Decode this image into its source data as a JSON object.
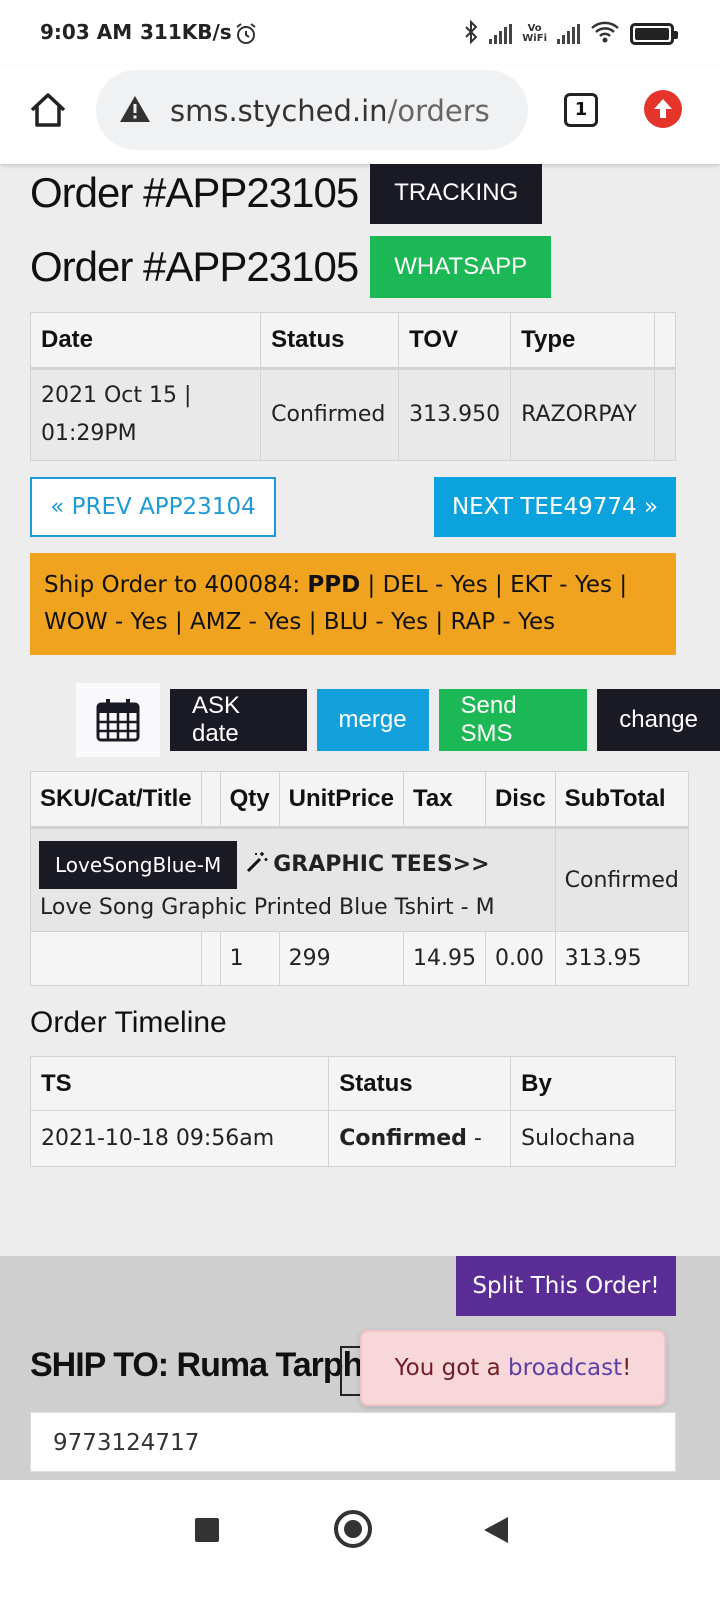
{
  "status_bar": {
    "time": "9:03 AM",
    "speed": "311KB/s",
    "vo": "Vo",
    "wifi": "WiFi"
  },
  "browser": {
    "url_domain": "sms.styched.in",
    "url_path": "/orders",
    "tab_count": "1"
  },
  "order": {
    "title": "Order #APP23105",
    "tracking_label": "TRACKING",
    "whatsapp_label": "WHATSAPP"
  },
  "info_table": {
    "headers": [
      "Date",
      "Status",
      "TOV",
      "Type"
    ],
    "row": {
      "date_line1": "2021 Oct 15 |",
      "date_line2": "01:29PM",
      "status": "Confirmed",
      "tov": "313.950",
      "type": "RAZORPAY"
    }
  },
  "nav": {
    "prev_label": "« PREV APP23104",
    "next_label": "NEXT TEE49774 »"
  },
  "ship_alert": {
    "prefix": "Ship Order to 400084: ",
    "bold": "PPD",
    "rest": " | DEL - Yes | EKT - Yes | WOW - Yes | AMZ - Yes | BLU - Yes | RAP - Yes"
  },
  "actions": {
    "ask_date": "ASK date",
    "merge": "merge",
    "send_sms": "Send SMS",
    "change": "change"
  },
  "items_table": {
    "headers": [
      "SKU/Cat/Title",
      "",
      "Qty",
      "UnitPrice",
      "Tax",
      "Disc",
      "SubTotal"
    ],
    "item": {
      "sku": "LoveSongBlue-M",
      "category": "GRAPHIC TEES>>",
      "title": "Love Song Graphic Printed Blue Tshirt - M",
      "status": "Confirmed",
      "qty": "1",
      "unit_price": "299",
      "tax": "14.95",
      "disc": "0.00",
      "subtotal": "313.95"
    }
  },
  "timeline": {
    "title": "Order Timeline",
    "headers": [
      "TS",
      "Status",
      "By"
    ],
    "row": {
      "ts": "2021-10-18 09:56am",
      "status": "Confirmed",
      "status_suffix": " -",
      "by": "Sulochana"
    }
  },
  "lower": {
    "split_label": "Split This Order!",
    "ship_to": "SHIP TO: Ruma Tarphe",
    "phone": "9773124717",
    "toast_prefix": "You got a ",
    "toast_link": "broadcast",
    "toast_suffix": "!"
  },
  "colors": {
    "dark_button": "#1a1a24",
    "green": "#1cb855",
    "blue": "#14a0da",
    "alert_orange": "#f0a31f",
    "purple": "#5a2d96",
    "toast_bg": "#f8d7da"
  }
}
